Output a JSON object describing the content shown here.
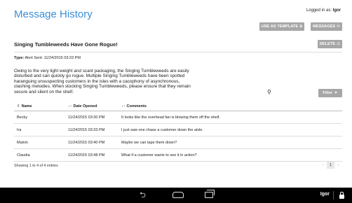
{
  "page": {
    "title": "Message History"
  },
  "session": {
    "label": "Logged in as:",
    "user": "Igor"
  },
  "toolbar": {
    "template_label": "USE AS TEMPLATE",
    "template_icon": "external-link-icon",
    "messages_label": "MESSAGES",
    "messages_icon": "envelope-icon"
  },
  "message": {
    "title": "Singing Tumbleweeds Have Gone Rogue!",
    "delete_label": "DELETE",
    "delete_icon": "list-icon",
    "type_label": "Type:",
    "type_value": "Alert Sent: 11/24/2015 03:23 PM",
    "body": "Owing to the very light weight and scant packaging, the Singing Tumbleweeds are easily disturbed and can quickly go rogue. Multiple Singing Tumbleweeds have been spotted haranguing unsuspecting customers in the isles with a cacophony of asynchronous, clashing melodies. When stocking Singing Tumbleweeds, please ensure that they remain secure and silent on the shelf."
  },
  "filter": {
    "label": "Filter",
    "icon": "funnel-icon"
  },
  "table": {
    "headers": {
      "name": "Name",
      "date": "Date Opened",
      "comments": "Comments"
    },
    "rows": [
      {
        "name": "Becky",
        "date": "11/24/2015 03:30 PM",
        "comment": "It looks like the overhead fan is blowing them off the shelf."
      },
      {
        "name": "Ira",
        "date": "11/24/2015 03:33 PM",
        "comment": "I just saw one chase a customer down the aisle."
      },
      {
        "name": "Malvin",
        "date": "11/24/2015 03:40 PM",
        "comment": "Maybe we can tape them down?"
      },
      {
        "name": "Claudia",
        "date": "11/24/2015 03:48 PM",
        "comment": "What if a customer wants to see it in action?"
      }
    ]
  },
  "pagination": {
    "info": "Showing 1 to 4 of 4 entries",
    "prev": "‹",
    "current": "1",
    "next": "›"
  },
  "navbar": {
    "user": "Igor"
  }
}
